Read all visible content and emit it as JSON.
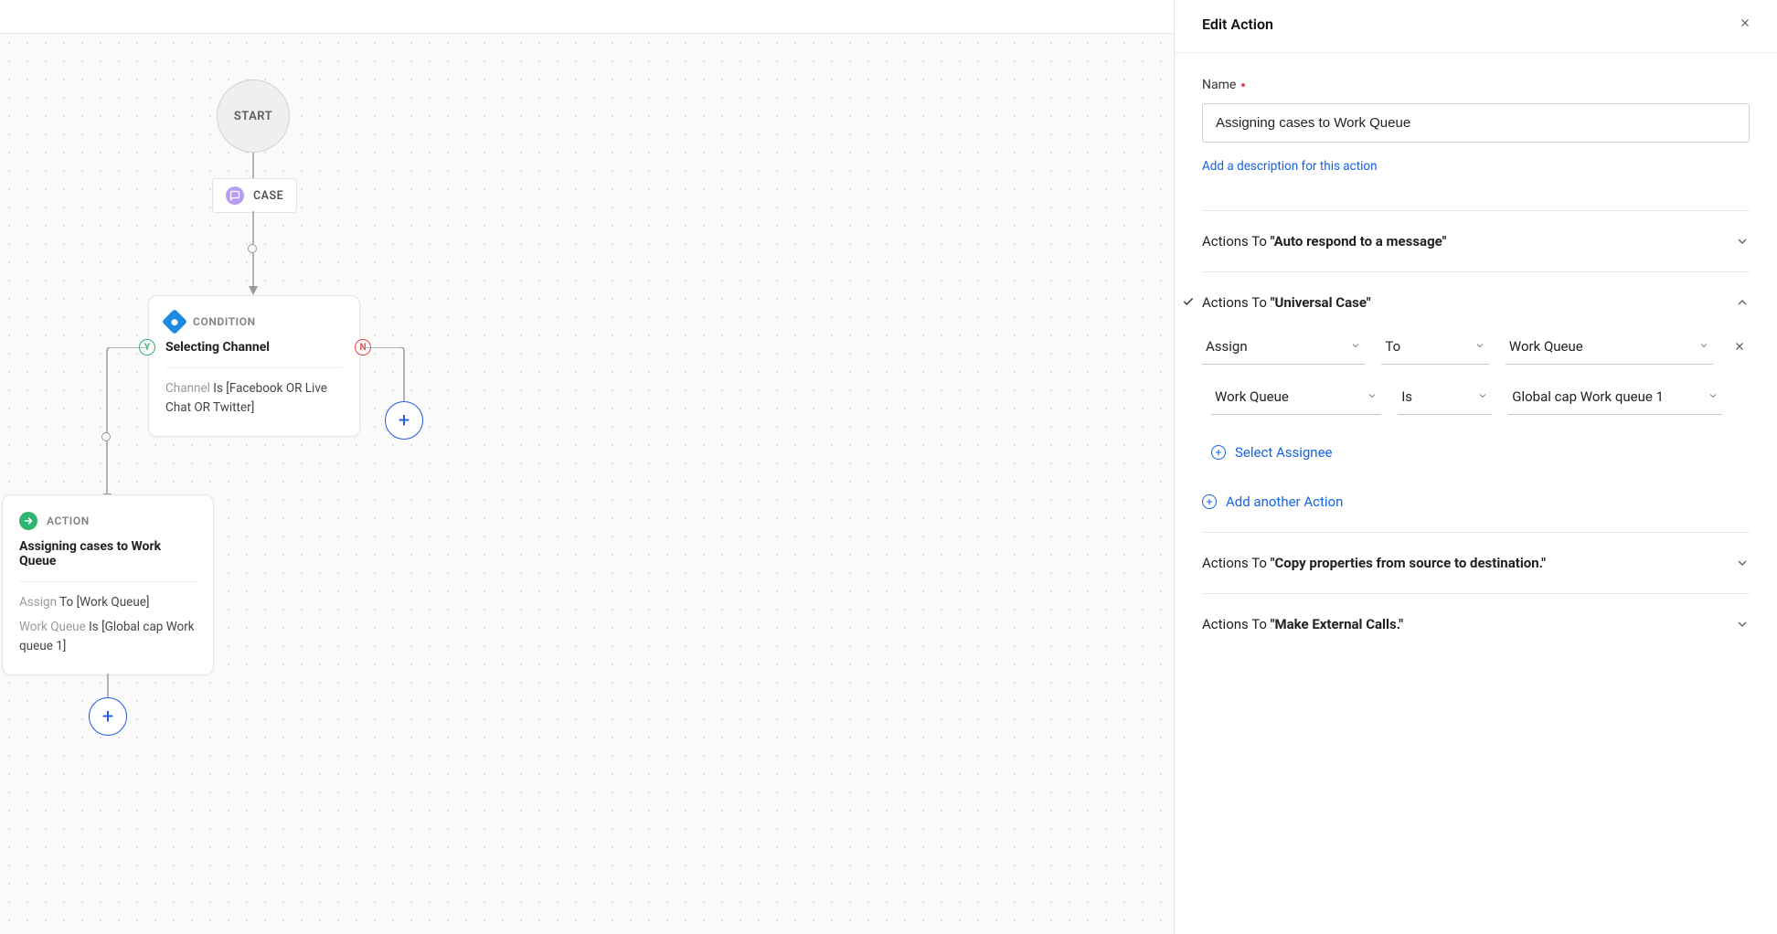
{
  "panel": {
    "title": "Edit Action",
    "name_label": "Name",
    "name_value": "Assigning cases to Work Queue",
    "add_desc": "Add a description for this action",
    "sections": {
      "auto_respond": {
        "prefix": "Actions To ",
        "bold": "\"Auto respond to a message\""
      },
      "universal": {
        "prefix": "Actions To ",
        "bold": "\"Universal Case\"",
        "row1": {
          "a": "Assign",
          "b": "To",
          "c": "Work Queue"
        },
        "row2": {
          "a": "Work Queue",
          "b": "Is",
          "c": "Global cap Work queue 1"
        },
        "select_assignee": "Select Assignee",
        "add_another": "Add another Action"
      },
      "copy_props": {
        "prefix": "Actions To ",
        "bold": "\"Copy properties from source to destination.\""
      },
      "external": {
        "prefix": "Actions To ",
        "bold": "\"Make External Calls.\""
      }
    }
  },
  "canvas": {
    "start": "START",
    "case": "CASE",
    "yes": "Y",
    "no": "N",
    "condition": {
      "label": "CONDITION",
      "title": "Selecting Channel",
      "text_muted": "Channel ",
      "text_rest": "Is [Facebook OR Live Chat OR Twitter]"
    },
    "action": {
      "label": "ACTION",
      "title": "Assigning cases to Work Queue",
      "line1_muted": "Assign ",
      "line1_rest": "To [Work Queue]",
      "line2_muted": "Work Queue ",
      "line2_rest": "Is [Global cap Work queue 1]"
    }
  }
}
